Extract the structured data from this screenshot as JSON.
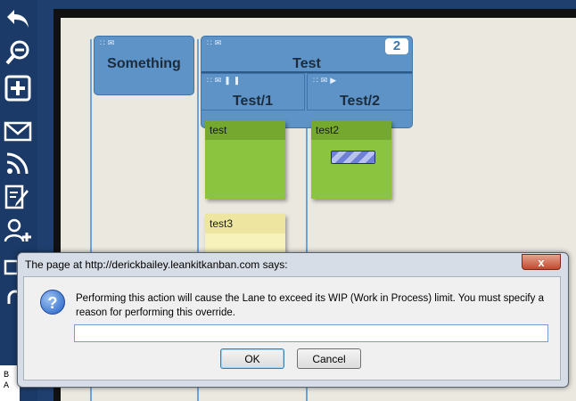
{
  "toolbar": {
    "icons": [
      "undo-icon",
      "zoom-out-icon",
      "add-card-icon",
      "email-icon",
      "rss-icon",
      "edit-icon",
      "add-user-icon",
      "puzzle-icon",
      "lock-icon"
    ],
    "board_letters": "B\nA"
  },
  "board": {
    "lanes": [
      {
        "title": "Something"
      },
      {
        "title": "Test",
        "wip": "2"
      },
      {
        "title": "Test/1"
      },
      {
        "title": "Test/2"
      }
    ],
    "cards": [
      {
        "title": "test",
        "color": "#8bc43f"
      },
      {
        "title": "test2",
        "color": "#8bc43f",
        "progress": 0.5
      },
      {
        "title": "test3",
        "color": "#f7f1bb"
      }
    ]
  },
  "dialog": {
    "title": "The page at http://derickbailey.leankitkanban.com says:",
    "close_label": "x",
    "message": "Performing this action will cause the Lane to exceed its WIP (Work in Process) limit.  You must specify a reason for performing this override.",
    "input_value": "",
    "ok_label": "OK",
    "cancel_label": "Cancel"
  }
}
